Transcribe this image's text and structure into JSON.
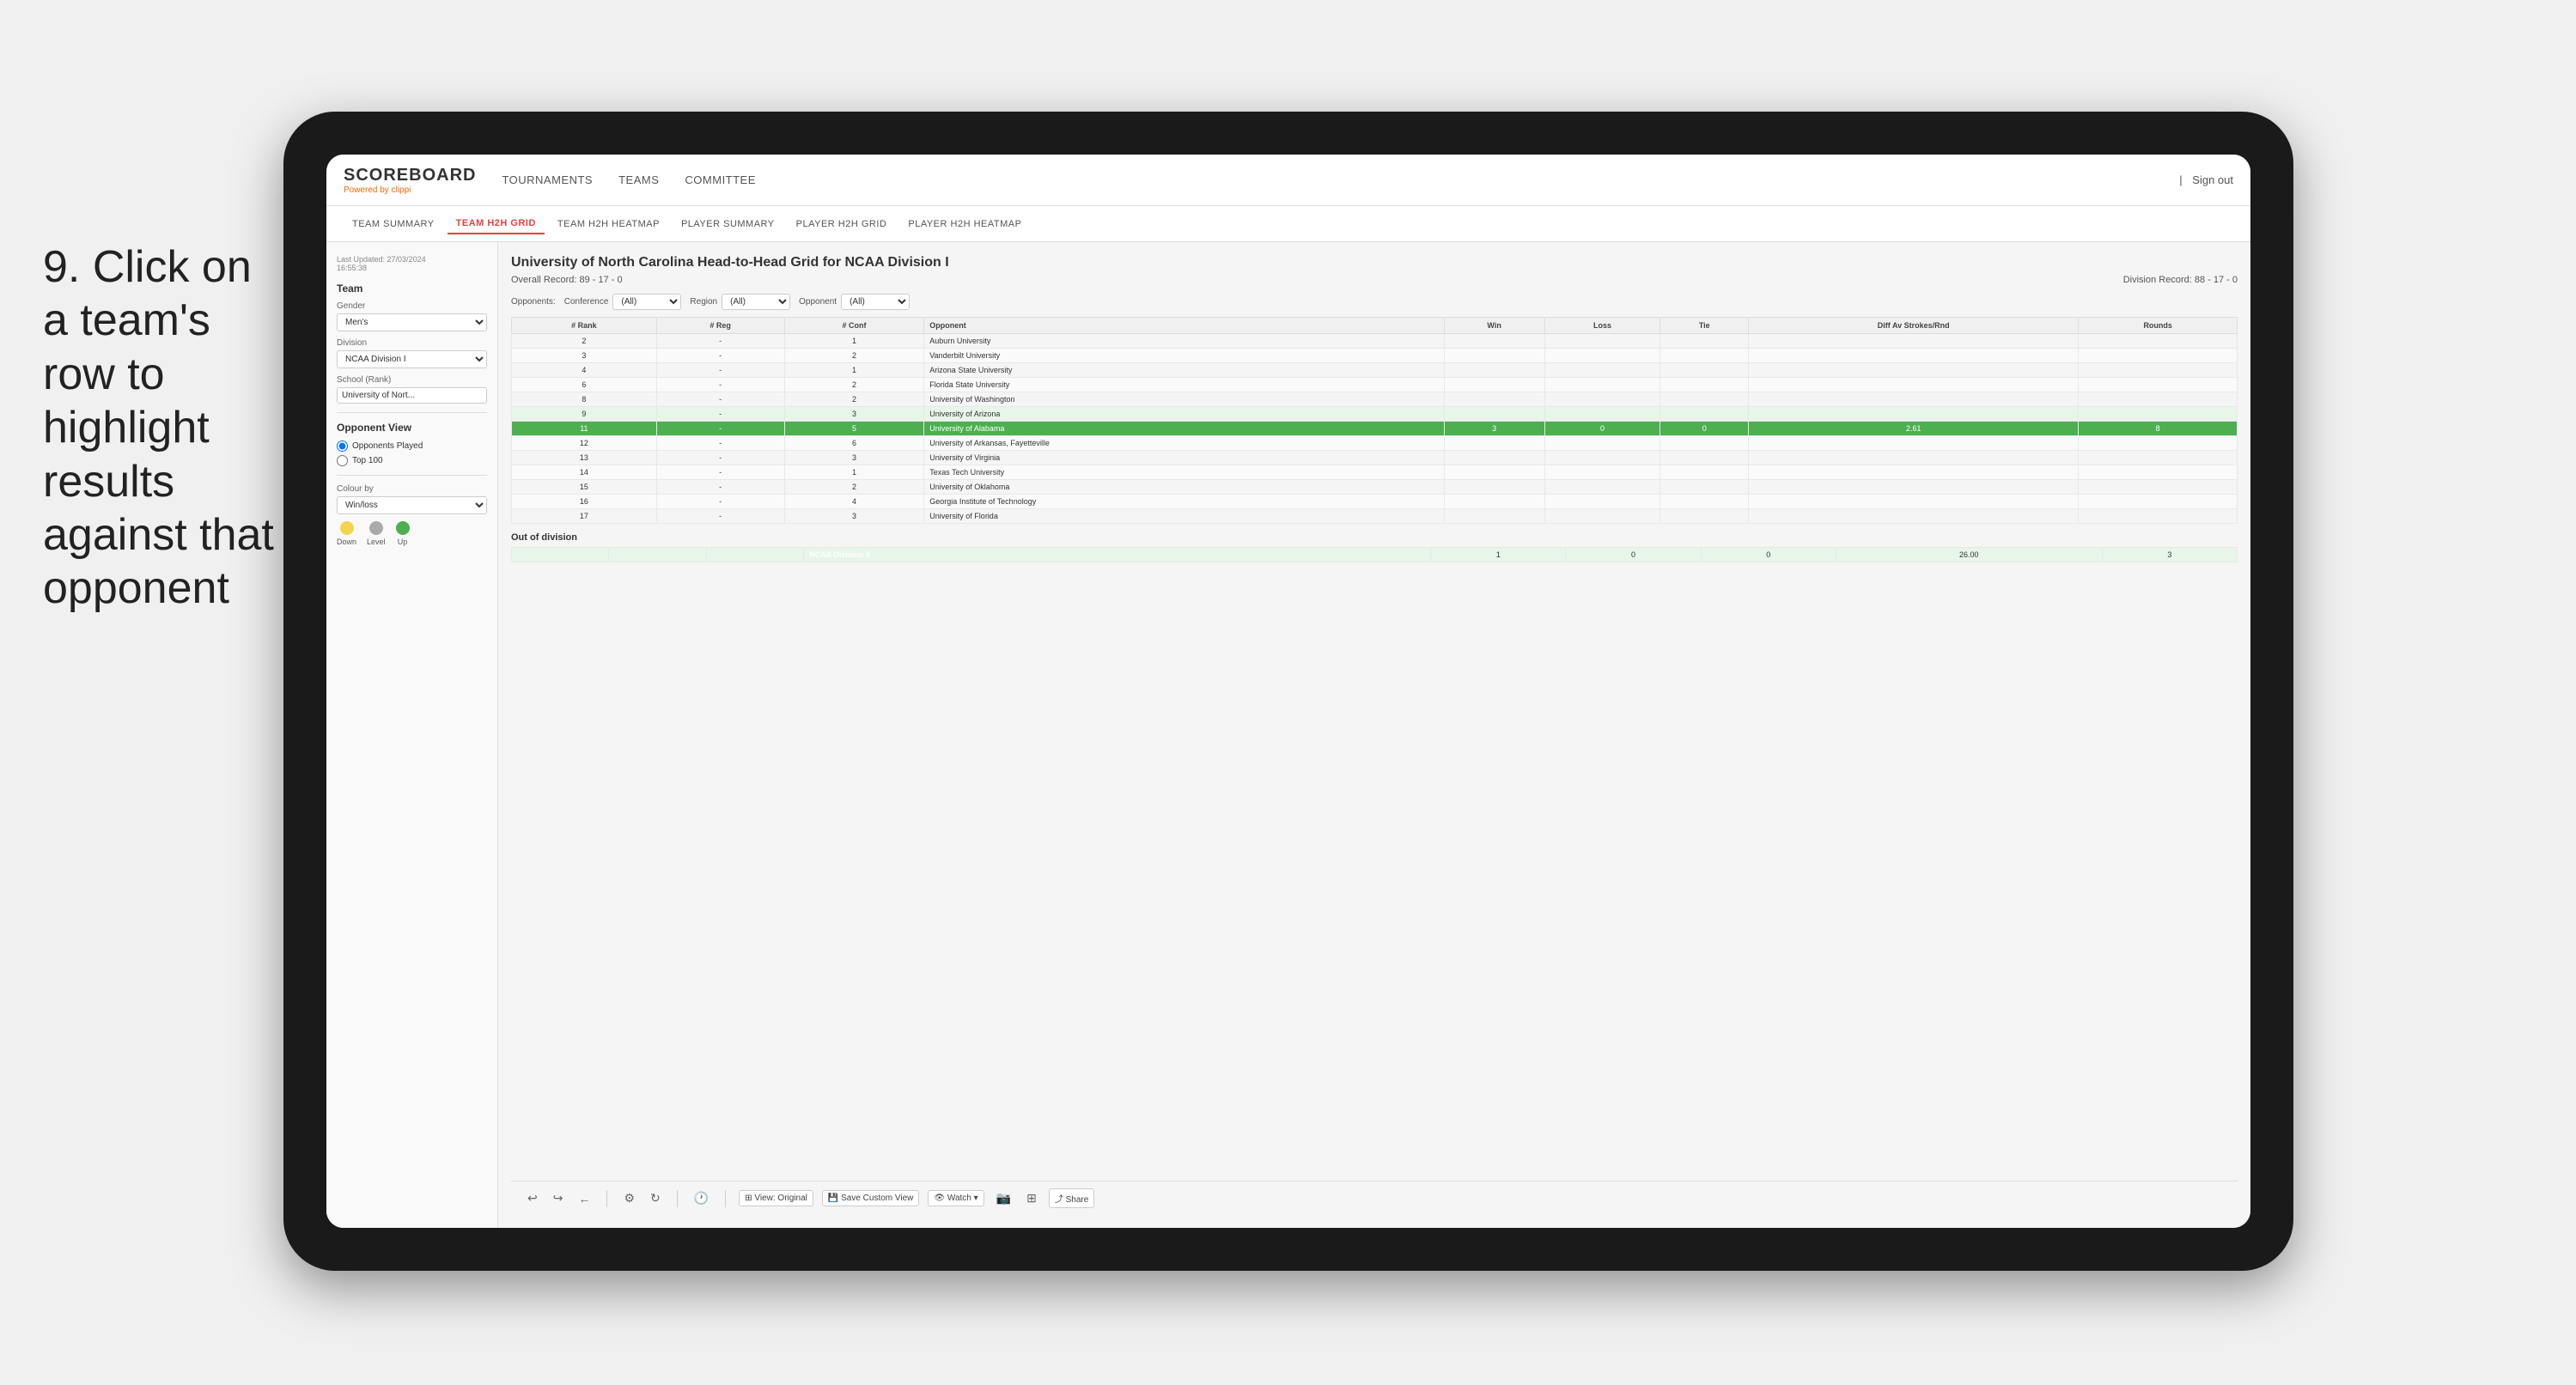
{
  "instruction": {
    "number": "9.",
    "text": "Click on a team's row to highlight results against that opponent"
  },
  "tablet": {
    "topNav": {
      "logo": "SCOREBOARD",
      "logoPoweredBy": "Powered by",
      "logoBrand": "clippi",
      "navItems": [
        "TOURNAMENTS",
        "TEAMS",
        "COMMITTEE"
      ],
      "signOut": "Sign out"
    },
    "subNav": {
      "tabs": [
        "TEAM SUMMARY",
        "TEAM H2H GRID",
        "TEAM H2H HEATMAP",
        "PLAYER SUMMARY",
        "PLAYER H2H GRID",
        "PLAYER H2H HEATMAP"
      ],
      "activeTab": "TEAM H2H GRID"
    },
    "leftPanel": {
      "lastUpdated": "Last Updated: 27/03/2024",
      "lastUpdatedTime": "16:55:38",
      "teamLabel": "Team",
      "genderLabel": "Gender",
      "genderValue": "Men's",
      "divisionLabel": "Division",
      "divisionValue": "NCAA Division I",
      "schoolLabel": "School (Rank)",
      "schoolValue": "University of Nort...",
      "opponentViewLabel": "Opponent View",
      "opponentOptions": [
        "Opponents Played",
        "Top 100"
      ],
      "selectedOpponent": "Opponents Played",
      "colourByLabel": "Colour by",
      "colourByValue": "Win/loss",
      "legendItems": [
        {
          "label": "Down",
          "color": "#f4d44d"
        },
        {
          "label": "Level",
          "color": "#aaa"
        },
        {
          "label": "Up",
          "color": "#4caf50"
        }
      ]
    },
    "mainContent": {
      "title": "University of North Carolina Head-to-Head Grid for NCAA Division I",
      "overallRecord": "Overall Record: 89 - 17 - 0",
      "divisionRecord": "Division Record: 88 - 17 - 0",
      "filters": {
        "conferenceLabel": "Conference",
        "conferenceValue": "(All)",
        "regionLabel": "Region",
        "regionValue": "(All)",
        "opponentLabel": "Opponent",
        "opponentValue": "(All)",
        "opponentsLabel": "Opponents:"
      },
      "tableHeaders": [
        "# Rank",
        "# Reg",
        "# Conf",
        "Opponent",
        "Win",
        "Loss",
        "Tie",
        "Diff Av Strokes/Rnd",
        "Rounds"
      ],
      "tableRows": [
        {
          "rank": "2",
          "reg": "-",
          "conf": "1",
          "opponent": "Auburn University",
          "win": "",
          "loss": "",
          "tie": "",
          "diff": "",
          "rounds": "",
          "rowStyle": "normal"
        },
        {
          "rank": "3",
          "reg": "-",
          "conf": "2",
          "opponent": "Vanderbilt University",
          "win": "",
          "loss": "",
          "tie": "",
          "diff": "",
          "rounds": "",
          "rowStyle": "normal"
        },
        {
          "rank": "4",
          "reg": "-",
          "conf": "1",
          "opponent": "Arizona State University",
          "win": "",
          "loss": "",
          "tie": "",
          "diff": "",
          "rounds": "",
          "rowStyle": "normal"
        },
        {
          "rank": "6",
          "reg": "-",
          "conf": "2",
          "opponent": "Florida State University",
          "win": "",
          "loss": "",
          "tie": "",
          "diff": "",
          "rounds": "",
          "rowStyle": "normal"
        },
        {
          "rank": "8",
          "reg": "-",
          "conf": "2",
          "opponent": "University of Washington",
          "win": "",
          "loss": "",
          "tie": "",
          "diff": "",
          "rounds": "",
          "rowStyle": "normal"
        },
        {
          "rank": "9",
          "reg": "-",
          "conf": "3",
          "opponent": "University of Arizona",
          "win": "",
          "loss": "",
          "tie": "",
          "diff": "",
          "rounds": "",
          "rowStyle": "light-green"
        },
        {
          "rank": "11",
          "reg": "-",
          "conf": "5",
          "opponent": "University of Alabama",
          "win": "3",
          "loss": "0",
          "tie": "0",
          "diff": "2.61",
          "rounds": "8",
          "rowStyle": "highlighted"
        },
        {
          "rank": "12",
          "reg": "-",
          "conf": "6",
          "opponent": "University of Arkansas, Fayetteville",
          "win": "",
          "loss": "",
          "tie": "",
          "diff": "",
          "rounds": "",
          "rowStyle": "normal"
        },
        {
          "rank": "13",
          "reg": "-",
          "conf": "3",
          "opponent": "University of Virginia",
          "win": "",
          "loss": "",
          "tie": "",
          "diff": "",
          "rounds": "",
          "rowStyle": "normal"
        },
        {
          "rank": "14",
          "reg": "-",
          "conf": "1",
          "opponent": "Texas Tech University",
          "win": "",
          "loss": "",
          "tie": "",
          "diff": "",
          "rounds": "",
          "rowStyle": "normal"
        },
        {
          "rank": "15",
          "reg": "-",
          "conf": "2",
          "opponent": "University of Oklahoma",
          "win": "",
          "loss": "",
          "tie": "",
          "diff": "",
          "rounds": "",
          "rowStyle": "normal"
        },
        {
          "rank": "16",
          "reg": "-",
          "conf": "4",
          "opponent": "Georgia Institute of Technology",
          "win": "",
          "loss": "",
          "tie": "",
          "diff": "",
          "rounds": "",
          "rowStyle": "normal"
        },
        {
          "rank": "17",
          "reg": "-",
          "conf": "3",
          "opponent": "University of Florida",
          "win": "",
          "loss": "",
          "tie": "",
          "diff": "",
          "rounds": "",
          "rowStyle": "normal"
        }
      ],
      "outOfDivisionLabel": "Out of division",
      "outOfDivisionRows": [
        {
          "label": "NCAA Division II",
          "win": "1",
          "loss": "0",
          "tie": "0",
          "diff": "26.00",
          "rounds": "3"
        }
      ]
    },
    "bottomToolbar": {
      "undoLabel": "↩",
      "redoLabel": "↪",
      "backLabel": "←",
      "viewLabel": "⊞ View: Original",
      "saveCustomLabel": "💾 Save Custom View",
      "watchLabel": "👁 Watch ▾",
      "shareLabel": "⤴ Share"
    }
  }
}
